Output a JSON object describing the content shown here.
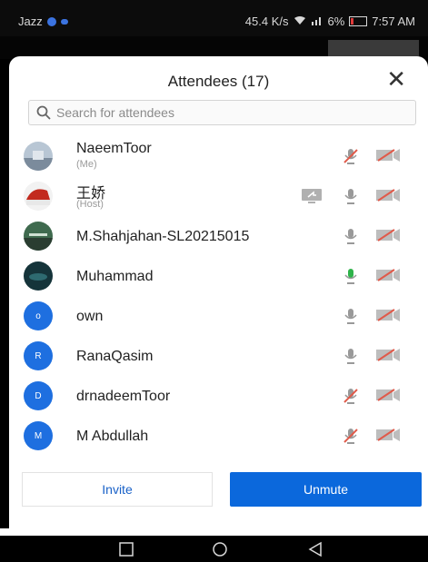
{
  "status_bar": {
    "carrier": "Jazz",
    "speed": "45.4 K/s",
    "battery": "6%",
    "time": "7:57 AM"
  },
  "dialog": {
    "title": "Attendees (17)",
    "close_label": "✕",
    "search_placeholder": "Search for attendees"
  },
  "attendees": [
    {
      "name": "NaeemToor",
      "sub": "(Me)",
      "avatar": "photo",
      "initial": "",
      "mic": "muted",
      "share": false
    },
    {
      "name": "王娇",
      "sub": "(Host)",
      "avatar": "photo",
      "initial": "",
      "mic": "off",
      "share": true
    },
    {
      "name": "M.Shahjahan-SL20215015",
      "sub": "",
      "avatar": "photo",
      "initial": "",
      "mic": "off",
      "share": false
    },
    {
      "name": "Muhammad",
      "sub": "",
      "avatar": "photo",
      "initial": "",
      "mic": "active",
      "share": false
    },
    {
      "name": "own",
      "sub": "",
      "avatar": "initial",
      "initial": "o",
      "mic": "off",
      "share": false
    },
    {
      "name": "RanaQasim",
      "sub": "",
      "avatar": "initial",
      "initial": "R",
      "mic": "off",
      "share": false
    },
    {
      "name": "drnadeemToor",
      "sub": "",
      "avatar": "initial",
      "initial": "D",
      "mic": "muted",
      "share": false
    },
    {
      "name": "M Abdullah",
      "sub": "",
      "avatar": "initial",
      "initial": "M",
      "mic": "muted",
      "share": false
    }
  ],
  "buttons": {
    "invite": "Invite",
    "unmute": "Unmute"
  },
  "colors": {
    "accent": "#0b68dc",
    "mic_muted": "#e05a4a",
    "mic_active": "#2fb34a",
    "mic_off": "#9a9a9a"
  }
}
